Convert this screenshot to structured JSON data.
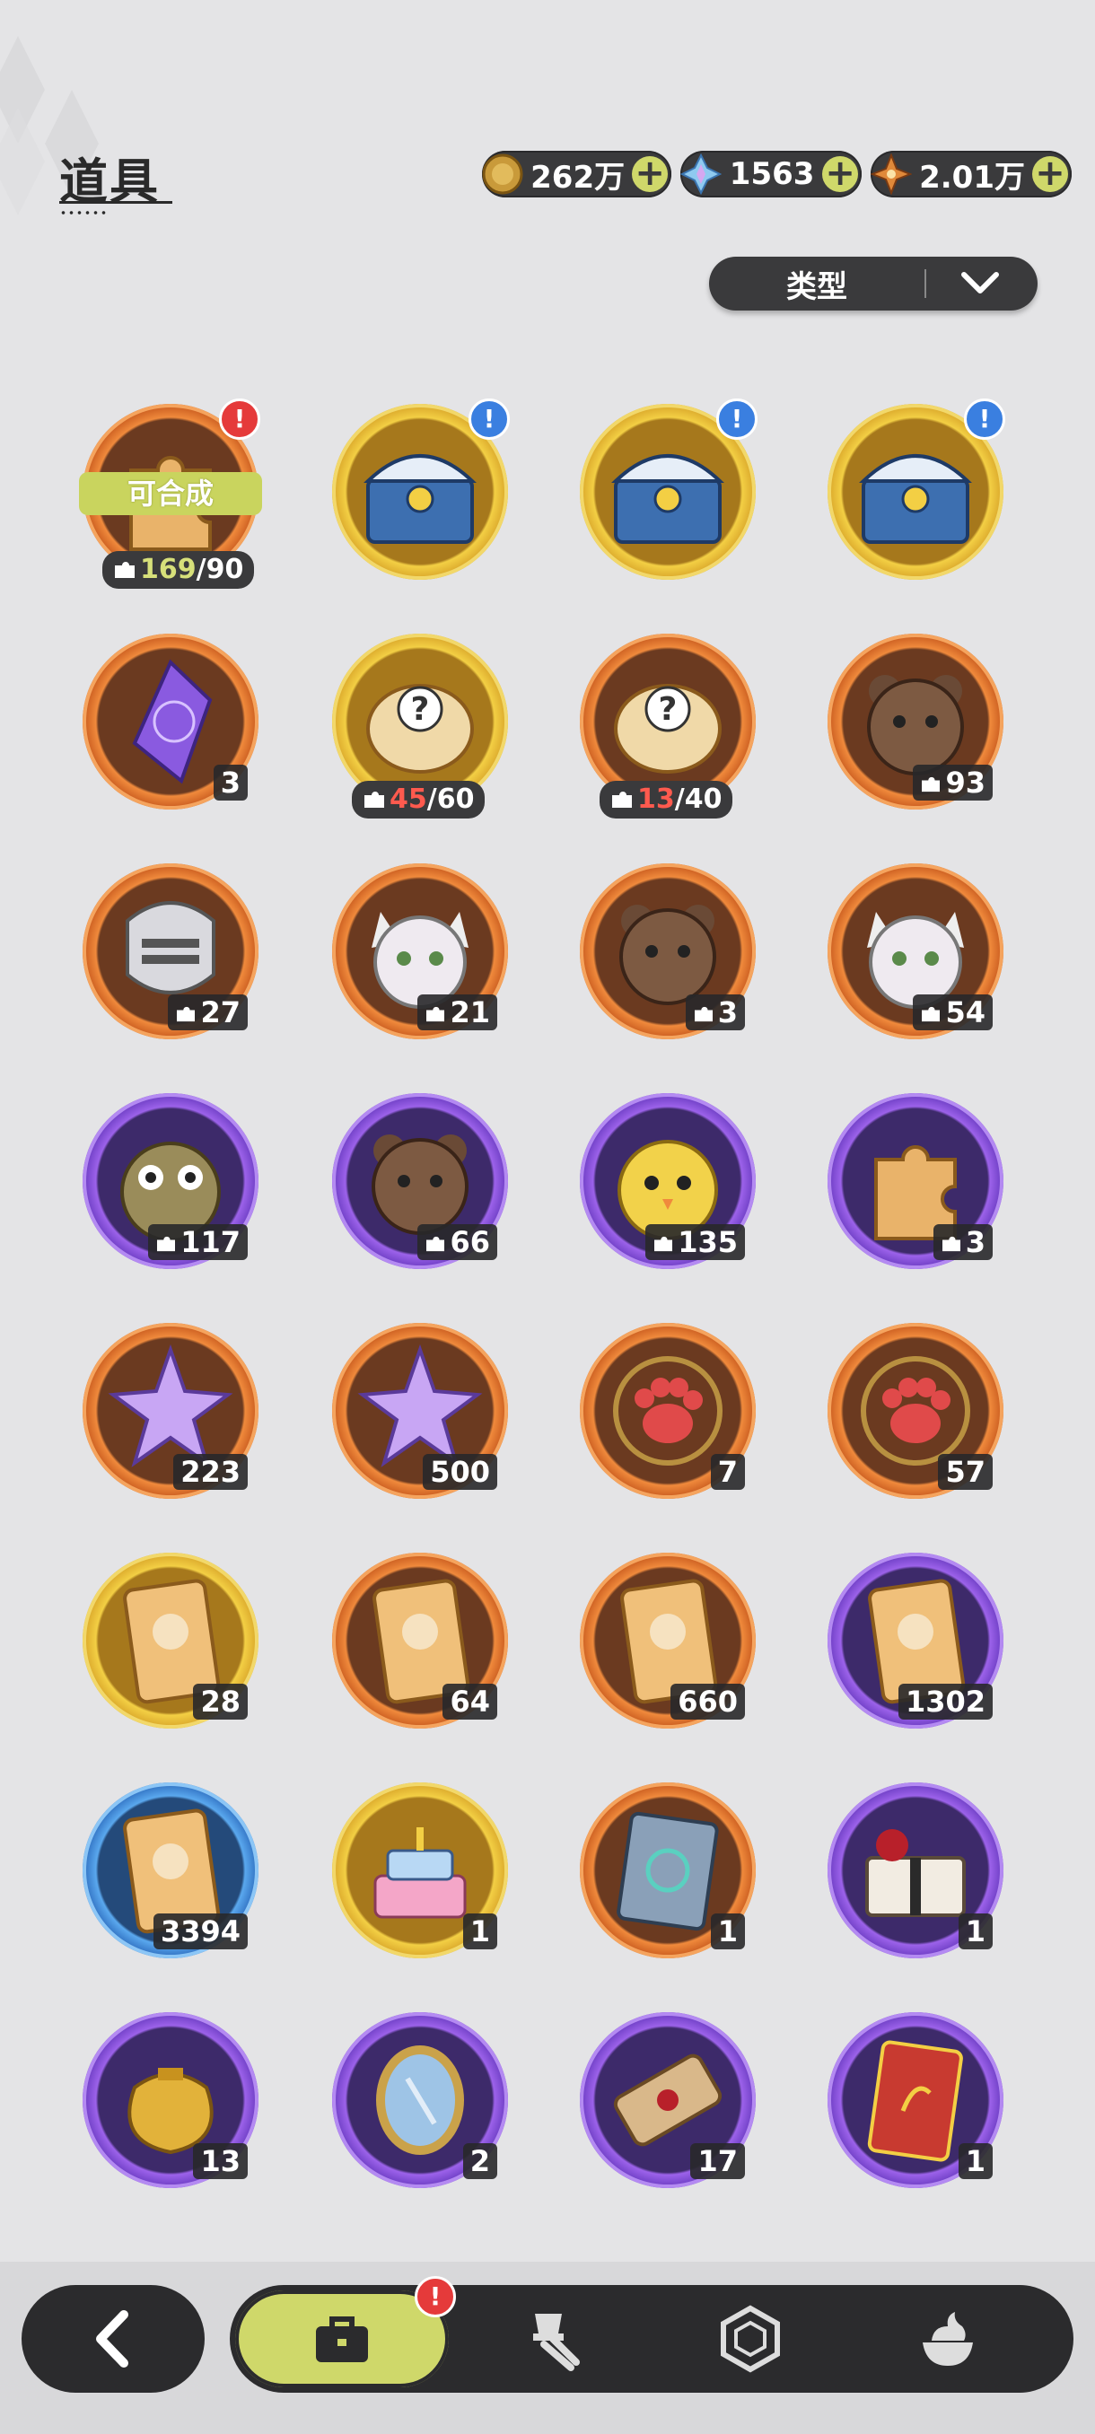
{
  "header": {
    "title": "道具"
  },
  "currencies": [
    {
      "name": "gold-coin-icon",
      "value": "262万",
      "color": "#c99a3a"
    },
    {
      "name": "crystal-gem-icon",
      "value": "1563",
      "color": "#7fc0ee"
    },
    {
      "name": "star-shard-icon",
      "value": "2.01万",
      "color": "#e0893a"
    }
  ],
  "filter": {
    "label": "类型"
  },
  "badges": {
    "alert": "!"
  },
  "synth_label": "可合成",
  "items": [
    {
      "name": "mascot-puzzle-fragment",
      "rarity": "orange",
      "icon": "puzzle-icon",
      "fragment": {
        "have": "169",
        "need": "/90",
        "enough": true
      },
      "badge": "red",
      "synth": true
    },
    {
      "name": "blue-treasure-chest",
      "rarity": "gold",
      "icon": "chest-icon",
      "badge": "blue"
    },
    {
      "name": "blue-treasure-chest",
      "rarity": "gold",
      "icon": "chest-icon",
      "badge": "blue"
    },
    {
      "name": "blue-treasure-chest",
      "rarity": "gold",
      "icon": "chest-icon",
      "badge": "blue"
    },
    {
      "name": "purple-crystal-relic",
      "rarity": "orange",
      "icon": "crystal-icon",
      "count": "3"
    },
    {
      "name": "mystery-fragment-gold",
      "rarity": "gold",
      "icon": "mystery-icon",
      "fragment": {
        "have": "45",
        "need": "/60",
        "enough": false
      }
    },
    {
      "name": "mystery-fragment-orange",
      "rarity": "orange",
      "icon": "mystery-icon",
      "fragment": {
        "have": "13",
        "need": "/40",
        "enough": false
      }
    },
    {
      "name": "bear-fragment",
      "rarity": "orange",
      "icon": "bear-icon",
      "count": "93",
      "frag_icon": true
    },
    {
      "name": "knight-fragment",
      "rarity": "orange",
      "icon": "knight-icon",
      "count": "27",
      "frag_icon": true
    },
    {
      "name": "white-cat-fragment",
      "rarity": "orange",
      "icon": "cat-icon",
      "count": "21",
      "frag_icon": true
    },
    {
      "name": "brown-bear-fragment",
      "rarity": "orange",
      "icon": "bear-icon",
      "count": "3",
      "frag_icon": true
    },
    {
      "name": "purple-cat-fragment",
      "rarity": "orange",
      "icon": "cat-icon",
      "count": "54",
      "frag_icon": true
    },
    {
      "name": "frog-fragment",
      "rarity": "purple",
      "icon": "frog-icon",
      "count": "117",
      "frag_icon": true
    },
    {
      "name": "eyepatch-bear-fragment",
      "rarity": "purple",
      "icon": "bear-icon",
      "count": "66",
      "frag_icon": true
    },
    {
      "name": "yellow-chick-fragment",
      "rarity": "purple",
      "icon": "chick-icon",
      "count": "135",
      "frag_icon": true
    },
    {
      "name": "purple-puzzle-fragment",
      "rarity": "purple",
      "icon": "puzzle-icon",
      "count": "3",
      "frag_icon": true
    },
    {
      "name": "pink-star-crystal",
      "rarity": "orange",
      "icon": "star-crystal-icon",
      "count": "223"
    },
    {
      "name": "blue-star-crystal",
      "rarity": "orange",
      "icon": "star-crystal-icon",
      "count": "500"
    },
    {
      "name": "red-paw-medal",
      "rarity": "orange",
      "icon": "paw-icon",
      "count": "7"
    },
    {
      "name": "gold-paw-medal",
      "rarity": "orange",
      "icon": "paw-icon",
      "count": "57"
    },
    {
      "name": "gold-character-card",
      "rarity": "gold",
      "icon": "card-icon",
      "count": "28"
    },
    {
      "name": "holo-character-card",
      "rarity": "orange",
      "icon": "card-icon",
      "count": "64"
    },
    {
      "name": "orange-character-card",
      "rarity": "orange",
      "icon": "card-icon",
      "count": "660"
    },
    {
      "name": "purple-character-card",
      "rarity": "purple",
      "icon": "card-icon",
      "count": "1302"
    },
    {
      "name": "blue-character-card",
      "rarity": "blue",
      "icon": "card-icon",
      "count": "3394"
    },
    {
      "name": "anniversary-cake",
      "rarity": "gold",
      "icon": "cake-icon",
      "count": "1"
    },
    {
      "name": "exchange-card-book",
      "rarity": "orange",
      "icon": "book-icon",
      "count": "1"
    },
    {
      "name": "rose-gift-box",
      "rarity": "purple",
      "icon": "gift-icon",
      "count": "1"
    },
    {
      "name": "golden-pouch",
      "rarity": "purple",
      "icon": "pouch-icon",
      "count": "13"
    },
    {
      "name": "magic-mirror",
      "rarity": "purple",
      "icon": "mirror-icon",
      "count": "2"
    },
    {
      "name": "ancient-scroll",
      "rarity": "purple",
      "icon": "scroll-icon",
      "count": "17"
    },
    {
      "name": "red-envelope-card",
      "rarity": "purple",
      "icon": "envelope-icon",
      "count": "1"
    }
  ],
  "nav": {
    "tabs": [
      {
        "name": "bag-icon",
        "active": true,
        "badge": "!"
      },
      {
        "name": "equipment-icon",
        "active": false
      },
      {
        "name": "hexagon-icon",
        "active": false
      },
      {
        "name": "dessert-icon",
        "active": false
      }
    ]
  }
}
